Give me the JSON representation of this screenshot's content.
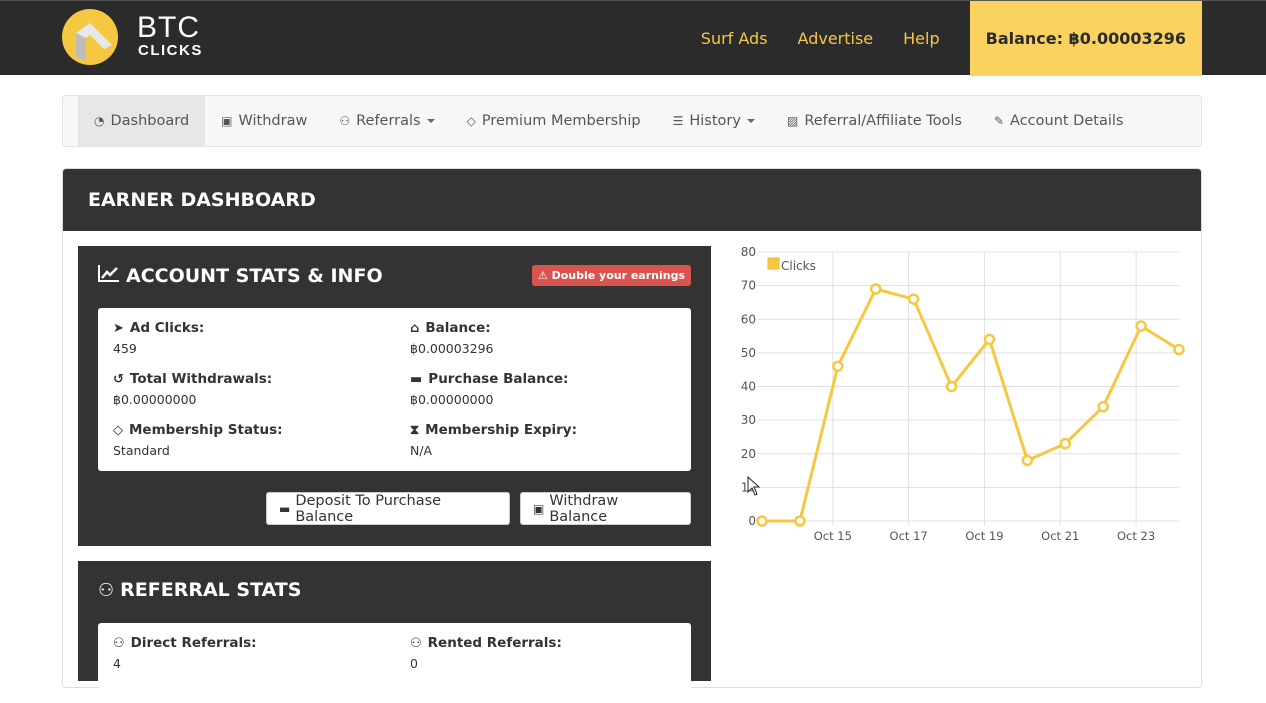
{
  "header": {
    "logo": {
      "line1": "BTC",
      "line2": "CLICKS"
    },
    "nav": [
      {
        "label": "Surf Ads"
      },
      {
        "label": "Advertise"
      },
      {
        "label": "Help"
      }
    ],
    "balance_label": "Balance: ฿0.00003296",
    "colors": {
      "brand_yellow": "#f6c842",
      "bar": "#2b2b2b"
    }
  },
  "menu": [
    {
      "label": "Dashboard",
      "icon": "dashboard-icon",
      "glyph": "◔",
      "active": true
    },
    {
      "label": "Withdraw",
      "icon": "money-icon",
      "glyph": "▣"
    },
    {
      "label": "Referrals",
      "icon": "users-icon",
      "glyph": "⚇",
      "dropdown": true
    },
    {
      "label": "Premium Membership",
      "icon": "diamond-icon",
      "glyph": "◇"
    },
    {
      "label": "History",
      "icon": "list-icon",
      "glyph": "☰",
      "dropdown": true
    },
    {
      "label": "Referral/Affiliate Tools",
      "icon": "image-icon",
      "glyph": "▨"
    },
    {
      "label": "Account Details",
      "icon": "edit-icon",
      "glyph": "✎"
    }
  ],
  "dashboard": {
    "title": "EARNER DASHBOARD",
    "account_stats": {
      "title": "ACCOUNT STATS & INFO",
      "badge": "⚠ Double your earnings",
      "items": [
        {
          "label": "Ad Clicks:",
          "value": "459",
          "icon": "pointer-icon",
          "glyph": "➤"
        },
        {
          "label": "Balance:",
          "value": "฿0.00003296",
          "icon": "bank-icon",
          "glyph": "⌂"
        },
        {
          "label": "Total Withdrawals:",
          "value": "฿0.00000000",
          "icon": "history-icon",
          "glyph": "↺"
        },
        {
          "label": "Purchase Balance:",
          "value": "฿0.00000000",
          "icon": "credit-card-icon",
          "glyph": "▬"
        },
        {
          "label": "Membership Status:",
          "value": "Standard",
          "icon": "diamond-icon",
          "glyph": "◇"
        },
        {
          "label": "Membership Expiry:",
          "value": "N/A",
          "icon": "hourglass-icon",
          "glyph": "⧗"
        }
      ],
      "buttons": {
        "deposit": "Deposit To Purchase Balance",
        "withdraw": "Withdraw Balance"
      }
    },
    "referral_stats": {
      "title": "REFERRAL STATS",
      "items": [
        {
          "label": "Direct Referrals:",
          "value": "4"
        },
        {
          "label": "Rented Referrals:",
          "value": "0"
        }
      ]
    }
  },
  "chart_data": {
    "type": "line",
    "title": "",
    "xlabel": "",
    "ylabel": "",
    "x": [
      "Oct 13",
      "Oct 14",
      "Oct 15",
      "Oct 16",
      "Oct 17",
      "Oct 18",
      "Oct 19",
      "Oct 20",
      "Oct 21",
      "Oct 22",
      "Oct 23",
      "Oct 24"
    ],
    "x_tick_labels": [
      "Oct 15",
      "Oct 17",
      "Oct 19",
      "Oct 21",
      "Oct 23"
    ],
    "series": [
      {
        "name": "Clicks",
        "color": "#f6c842",
        "values": [
          0,
          0,
          46,
          69,
          66,
          40,
          54,
          18,
          23,
          34,
          58,
          51
        ]
      }
    ],
    "ylim": [
      0,
      80
    ],
    "y_ticks": [
      0,
      10,
      20,
      30,
      40,
      50,
      60,
      70,
      80
    ],
    "grid": true,
    "legend": "top-left"
  }
}
